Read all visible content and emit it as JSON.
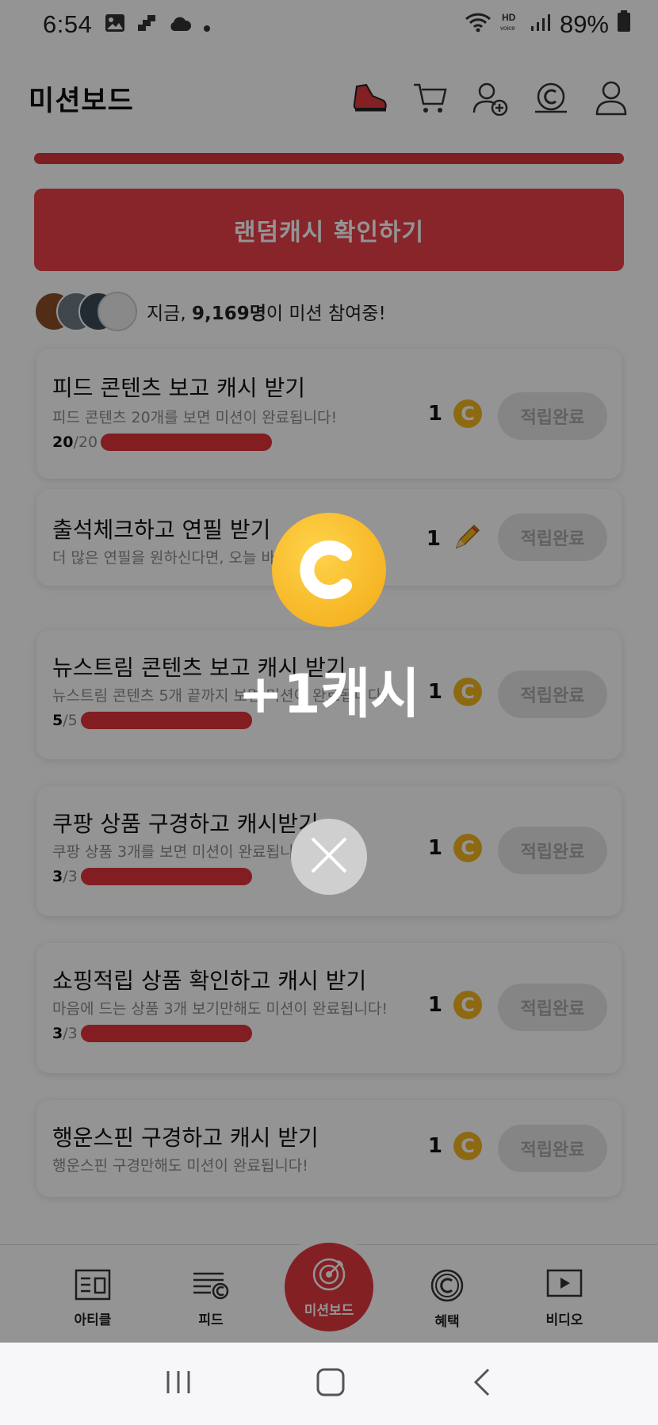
{
  "status_bar": {
    "time": "6:54",
    "battery": "89%"
  },
  "header": {
    "title": "미션보드"
  },
  "random_button": {
    "label": "랜덤캐시 확인하기"
  },
  "participants": {
    "prefix": "지금, ",
    "count": "9,169명",
    "suffix": "이 미션 참여중!"
  },
  "missions": [
    {
      "title": "피드 콘텐츠 보고 캐시 받기",
      "desc": "피드 콘텐츠 20개를 보면 미션이 완료됩니다!",
      "done": "20",
      "total": "/20",
      "reward": "1",
      "reward_icon": "coin-icon",
      "button": "적립완료",
      "progress": 1
    },
    {
      "title": "출석체크하고 연필 받기",
      "desc": "더 많은 연필을 원하신다면, 오늘 바로",
      "reward": "1",
      "reward_icon": "pencil-icon",
      "button": "적립완료"
    },
    {
      "title": "뉴스트림 콘텐츠 보고 캐시 받기",
      "desc": "뉴스트림 콘텐츠 5개 끝까지 보면 미션이 완료됩니다!",
      "done": "5",
      "total": "/5",
      "reward": "1",
      "reward_icon": "coin-icon",
      "button": "적립완료",
      "progress": 1
    },
    {
      "title": "쿠팡 상품 구경하고 캐시받기",
      "desc": "쿠팡 상품 3개를 보면 미션이 완료됩니다!",
      "done": "3",
      "total": "/3",
      "reward": "1",
      "reward_icon": "coin-icon",
      "button": "적립완료",
      "progress": 1
    },
    {
      "title": "쇼핑적립 상품 확인하고 캐시 받기",
      "desc": "마음에 드는 상품 3개 보기만해도 미션이 완료됩니다!",
      "done": "3",
      "total": "/3",
      "reward": "1",
      "reward_icon": "coin-icon",
      "button": "적립완료",
      "progress": 1
    },
    {
      "title": "행운스핀 구경하고 캐시 받기",
      "desc": "행운스핀 구경만해도 미션이 완료됩니다!",
      "reward": "1",
      "reward_icon": "coin-icon",
      "button": "적립완료"
    }
  ],
  "bottom_nav": {
    "article": "아티클",
    "feed": "피드",
    "mission": "미션보드",
    "benefit": "혜택",
    "video": "비디오"
  },
  "overlay": {
    "reward_text": "+1캐시",
    "coin_letter": "C"
  },
  "colors": {
    "accent": "#e2373f",
    "coin": "#f3b51f"
  }
}
